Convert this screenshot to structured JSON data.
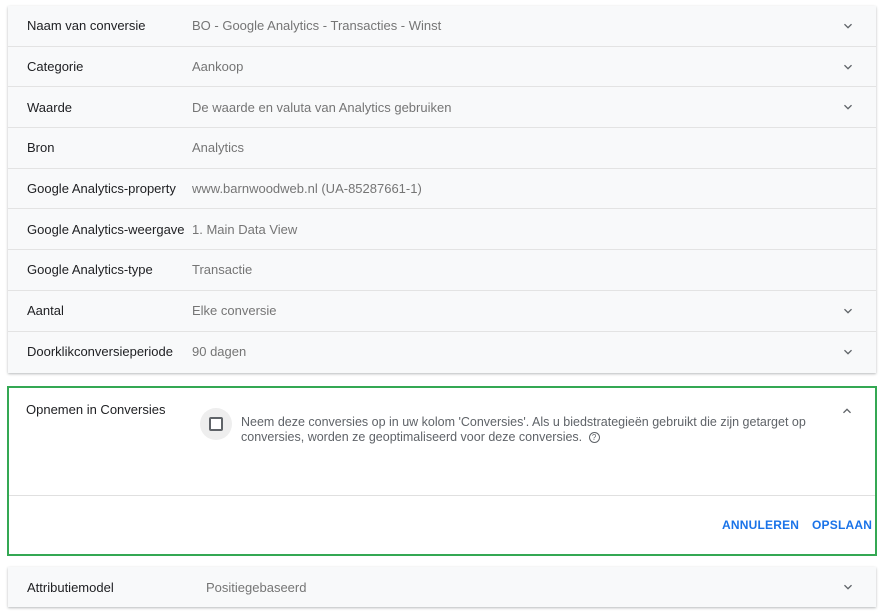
{
  "rows": [
    {
      "label": "Naam van conversie",
      "value": "BO - Google Analytics - Transacties - Winst",
      "dropdown": true
    },
    {
      "label": "Categorie",
      "value": "Aankoop",
      "dropdown": true
    },
    {
      "label": "Waarde",
      "value": "De waarde en valuta van Analytics gebruiken",
      "dropdown": true
    },
    {
      "label": "Bron",
      "value": "Analytics",
      "dropdown": false
    },
    {
      "label": "Google Analytics-property",
      "value": "www.barnwoodweb.nl (UA-85287661-1)",
      "dropdown": false
    },
    {
      "label": "Google Analytics-weergave",
      "value": "1. Main Data View",
      "dropdown": false
    },
    {
      "label": "Google Analytics-type",
      "value": "Transactie",
      "dropdown": false
    },
    {
      "label": "Aantal",
      "value": "Elke conversie",
      "dropdown": true
    },
    {
      "label": "Doorklikconversieperiode",
      "value": "90 dagen",
      "dropdown": true
    }
  ],
  "include_section": {
    "label": "Opnemen in Conversies",
    "checkbox_checked": false,
    "description": "Neem deze conversies op in uw kolom 'Conversies'. Als u biedstrategieën gebruikt die zijn getarget op conversies, worden ze geoptimaliseerd voor deze conversies.",
    "help_icon": "?",
    "cancel_label": "ANNULEREN",
    "save_label": "OPSLAAN"
  },
  "attribution": {
    "label": "Attributiemodel",
    "value": "Positiegebaseerd"
  },
  "colors": {
    "accent": "#1a73e8",
    "highlight_border": "#34a853"
  }
}
